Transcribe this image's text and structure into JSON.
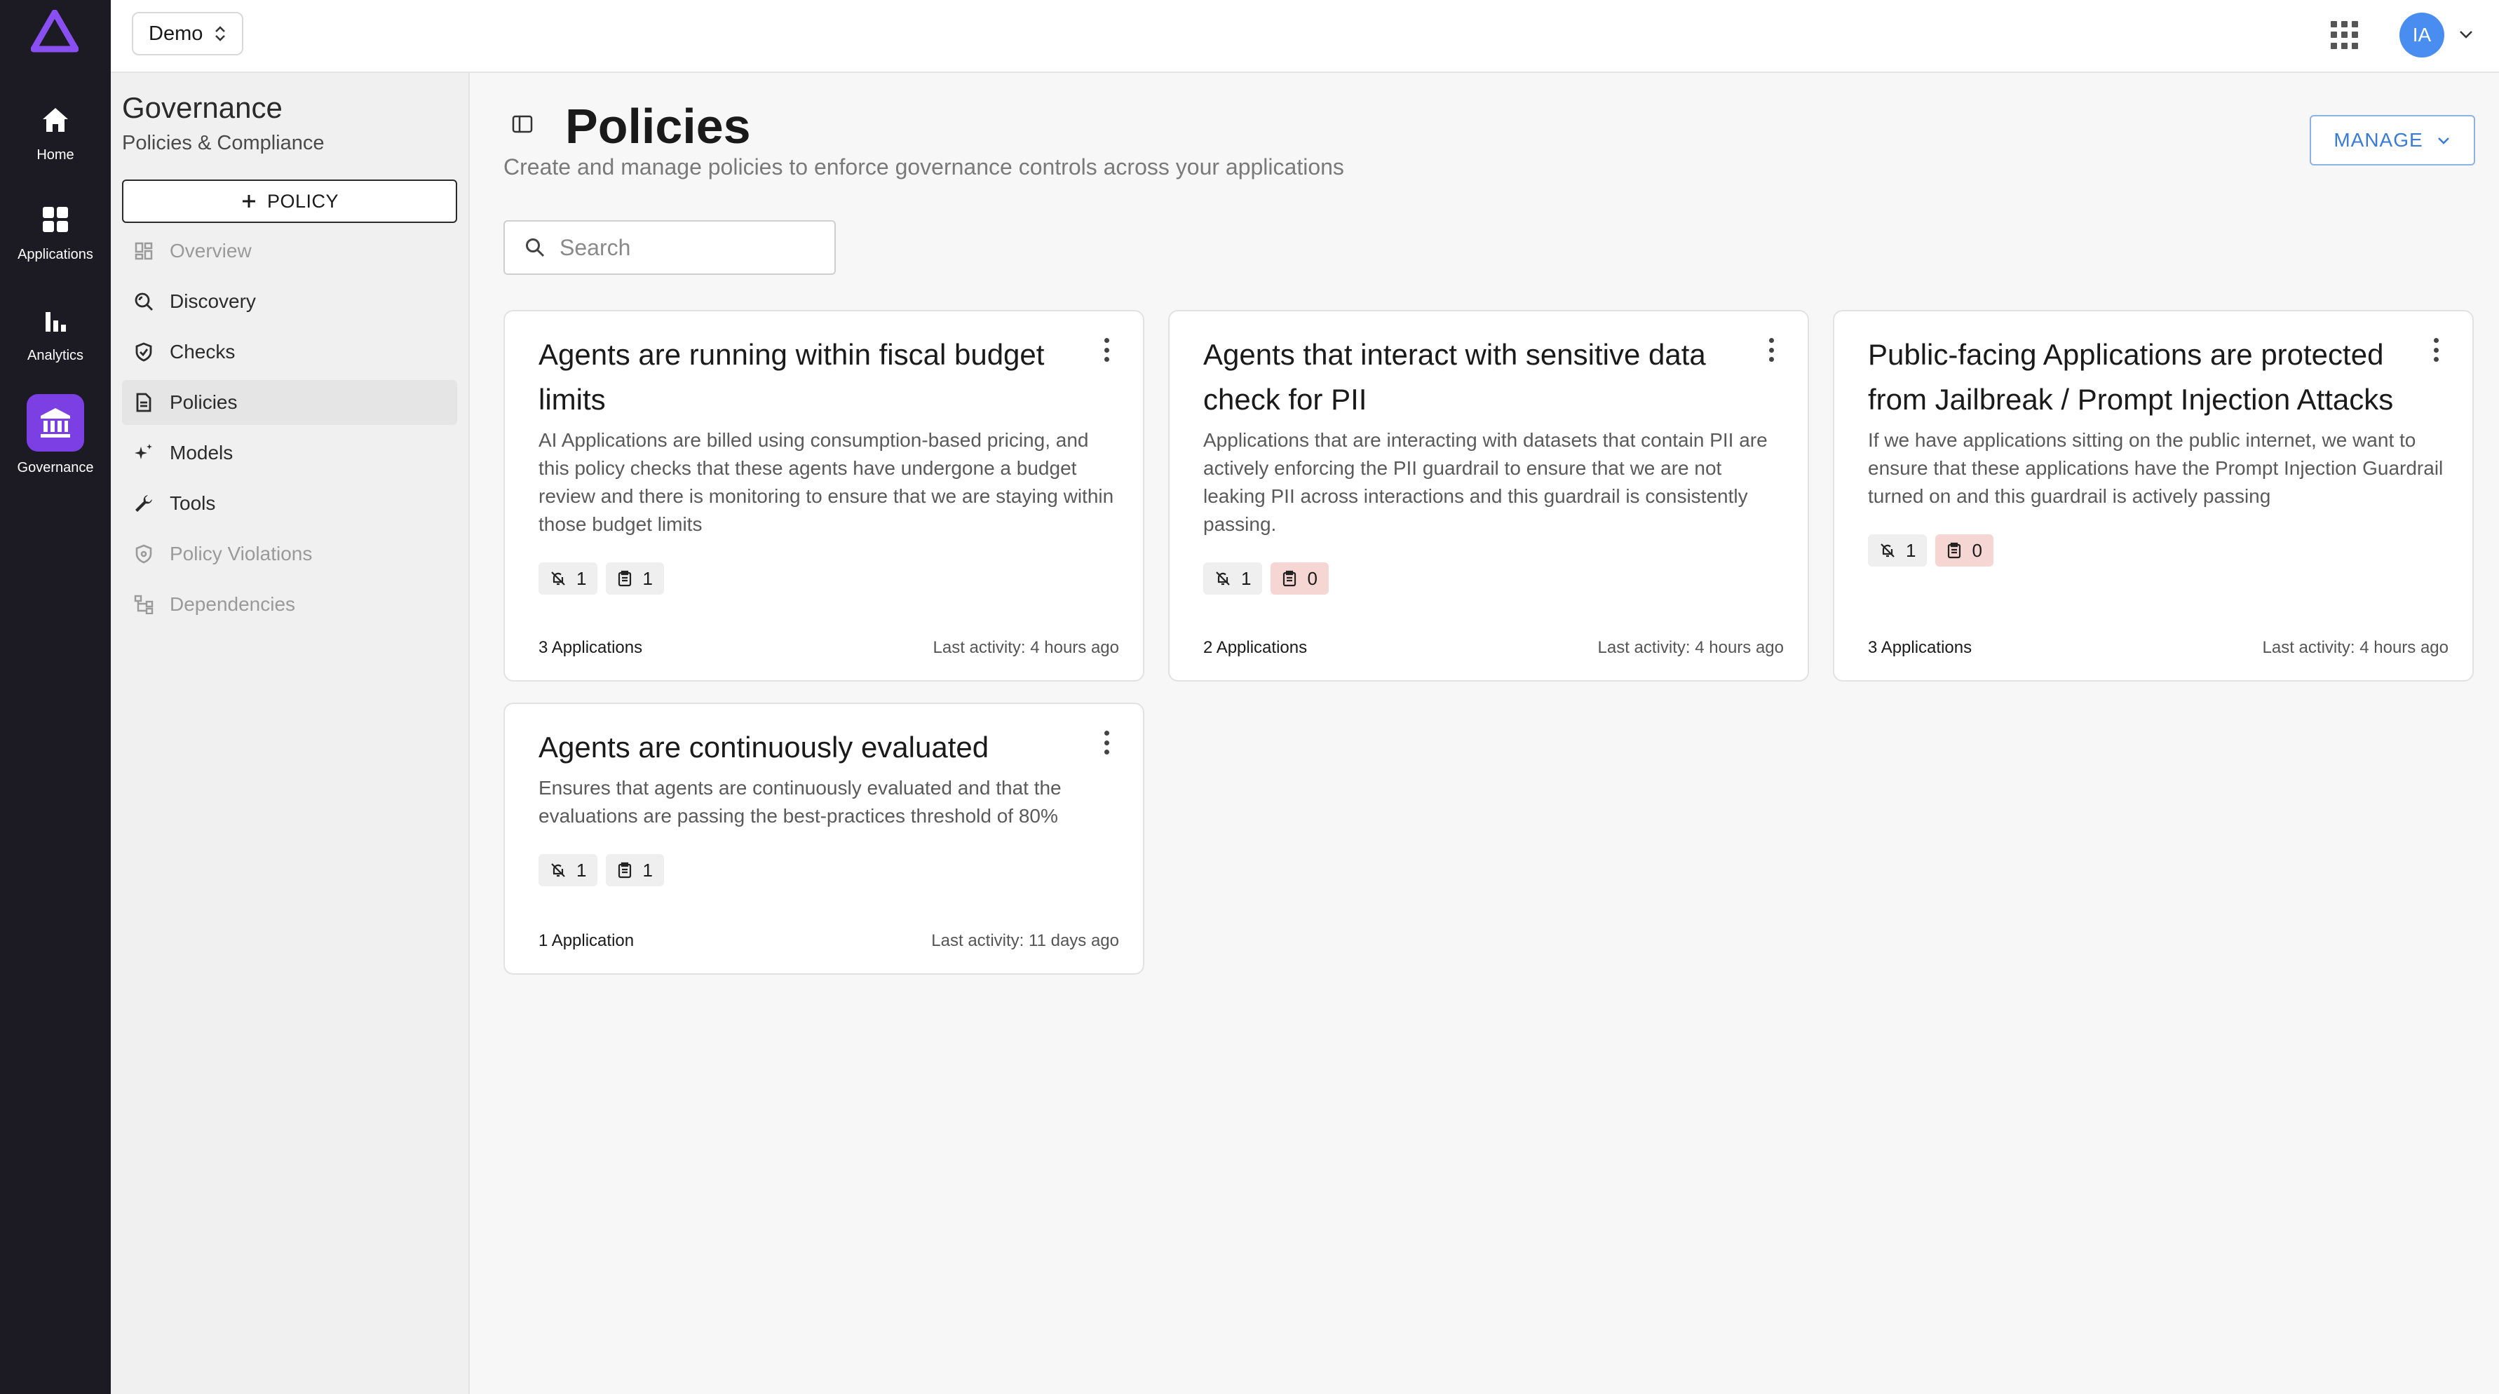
{
  "rail": {
    "items": [
      {
        "label": "Home",
        "icon": "home-icon"
      },
      {
        "label": "Applications",
        "icon": "apps-icon"
      },
      {
        "label": "Analytics",
        "icon": "bar-chart-icon"
      },
      {
        "label": "Governance",
        "icon": "bank-icon",
        "active": true
      }
    ]
  },
  "topbar": {
    "workspace": "Demo",
    "avatar_initials": "IA"
  },
  "sidebar": {
    "title": "Governance",
    "subtitle": "Policies & Compliance",
    "new_button": "POLICY",
    "items": [
      {
        "label": "Overview",
        "state": "disabled"
      },
      {
        "label": "Discovery",
        "state": "normal"
      },
      {
        "label": "Checks",
        "state": "normal"
      },
      {
        "label": "Policies",
        "state": "active"
      },
      {
        "label": "Models",
        "state": "normal"
      },
      {
        "label": "Tools",
        "state": "normal"
      },
      {
        "label": "Policy Violations",
        "state": "disabled"
      },
      {
        "label": "Dependencies",
        "state": "disabled"
      }
    ]
  },
  "main": {
    "title": "Policies",
    "subtitle": "Create and manage policies to enforce governance controls across your applications",
    "manage_label": "MANAGE",
    "search_placeholder": "Search",
    "cards": [
      {
        "title": "Agents are running within fiscal budget limits",
        "description": "AI Applications are billed using consumption-based pricing, and this policy checks that these agents have undergone a budget review and there is monitoring to ensure that we are staying within those budget limits",
        "alerts": "1",
        "checks": "1",
        "checks_status": "ok",
        "applications": "3 Applications",
        "last_activity": "Last activity: 4 hours ago"
      },
      {
        "title": "Agents that interact with sensitive data check for PII",
        "description": "Applications that are interacting with datasets that contain PII are actively enforcing the PII guardrail to ensure that we are not leaking PII across interactions and this guardrail is consistently passing.",
        "alerts": "1",
        "checks": "0",
        "checks_status": "fail",
        "applications": "2 Applications",
        "last_activity": "Last activity: 4 hours ago"
      },
      {
        "title": "Public-facing Applications are protected from Jailbreak / Prompt Injection Attacks",
        "description": "If we have applications sitting on the public internet, we want to ensure that these applications have the Prompt Injection Guardrail turned on and this guardrail is actively passing",
        "alerts": "1",
        "checks": "0",
        "checks_status": "fail",
        "applications": "3 Applications",
        "last_activity": "Last activity: 4 hours ago"
      },
      {
        "title": "Agents are continuously evaluated",
        "description": "Ensures that agents are continuously evaluated and that the evaluations are passing the best-practices threshold of 80%",
        "alerts": "1",
        "checks": "1",
        "checks_status": "ok",
        "applications": "1 Application",
        "last_activity": "Last activity: 11 days ago"
      }
    ]
  }
}
